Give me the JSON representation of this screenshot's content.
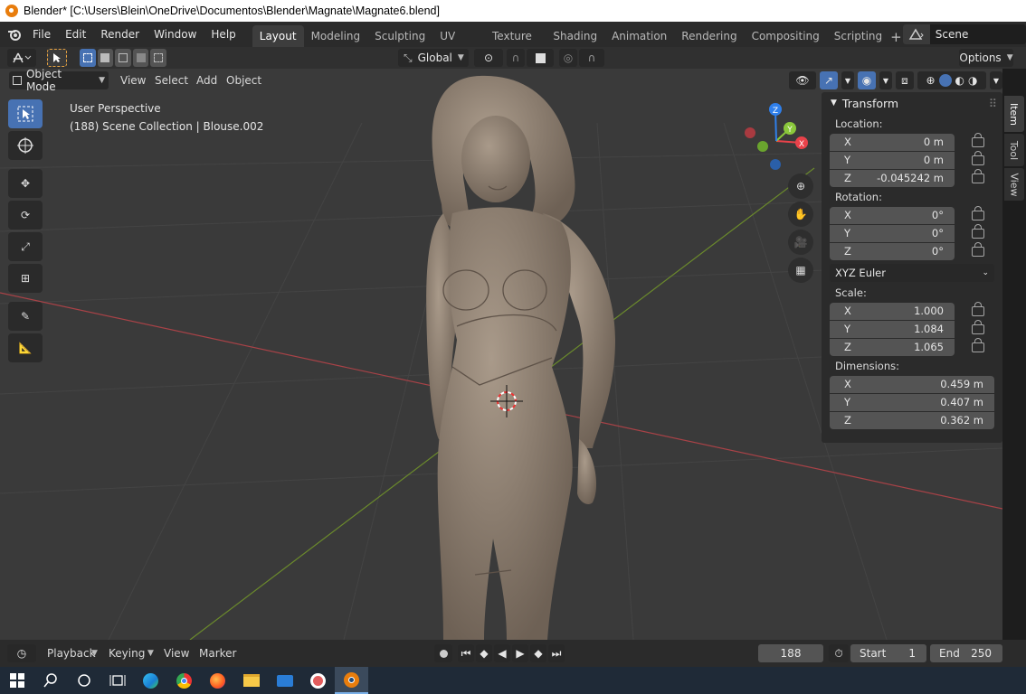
{
  "window": {
    "title": "Blender* [C:\\Users\\Blein\\OneDrive\\Documentos\\Blender\\Magnate\\Magnate6.blend]"
  },
  "menu": [
    "File",
    "Edit",
    "Render",
    "Window",
    "Help"
  ],
  "workspaces": {
    "active": "Layout",
    "tabs": [
      "Layout",
      "Modeling",
      "Sculpting",
      "UV Editing",
      "Texture Paint",
      "Shading",
      "Animation",
      "Rendering",
      "Compositing",
      "Scripting"
    ]
  },
  "scene": {
    "name": "Scene"
  },
  "header": {
    "orientation": "Global",
    "options_label": "Options"
  },
  "viewport_header": {
    "mode": "Object Mode",
    "menus": [
      "View",
      "Select",
      "Add",
      "Object"
    ]
  },
  "overlay": {
    "perspective": "User Perspective",
    "collection": "(188) Scene Collection | Blouse.002"
  },
  "gizmo": {
    "x": "X",
    "y": "Y",
    "z": "Z"
  },
  "n_panel": {
    "title": "Transform",
    "location": {
      "label": "Location:",
      "x": "0 m",
      "y": "0 m",
      "z": "-0.045242 m"
    },
    "rotation": {
      "label": "Rotation:",
      "x": "0°",
      "y": "0°",
      "z": "0°"
    },
    "rotation_mode": "XYZ Euler",
    "scale": {
      "label": "Scale:",
      "x": "1.000",
      "y": "1.084",
      "z": "1.065"
    },
    "dimensions": {
      "label": "Dimensions:",
      "x": "0.459 m",
      "y": "0.407 m",
      "z": "0.362 m"
    },
    "axis": {
      "x": "X",
      "y": "Y",
      "z": "Z"
    }
  },
  "side_tabs": [
    "Item",
    "Tool",
    "View"
  ],
  "timeline": {
    "menus": [
      "Playback",
      "Keying",
      "View",
      "Marker"
    ],
    "current_frame": "188",
    "start_label": "Start",
    "start": "1",
    "end_label": "End",
    "end": "250"
  },
  "colors": {
    "accent": "#4772b3",
    "x_axis": "#e8424a",
    "y_axis": "#8ac73b",
    "z_axis": "#2f7fea",
    "viewport": "#3a3a3a"
  }
}
